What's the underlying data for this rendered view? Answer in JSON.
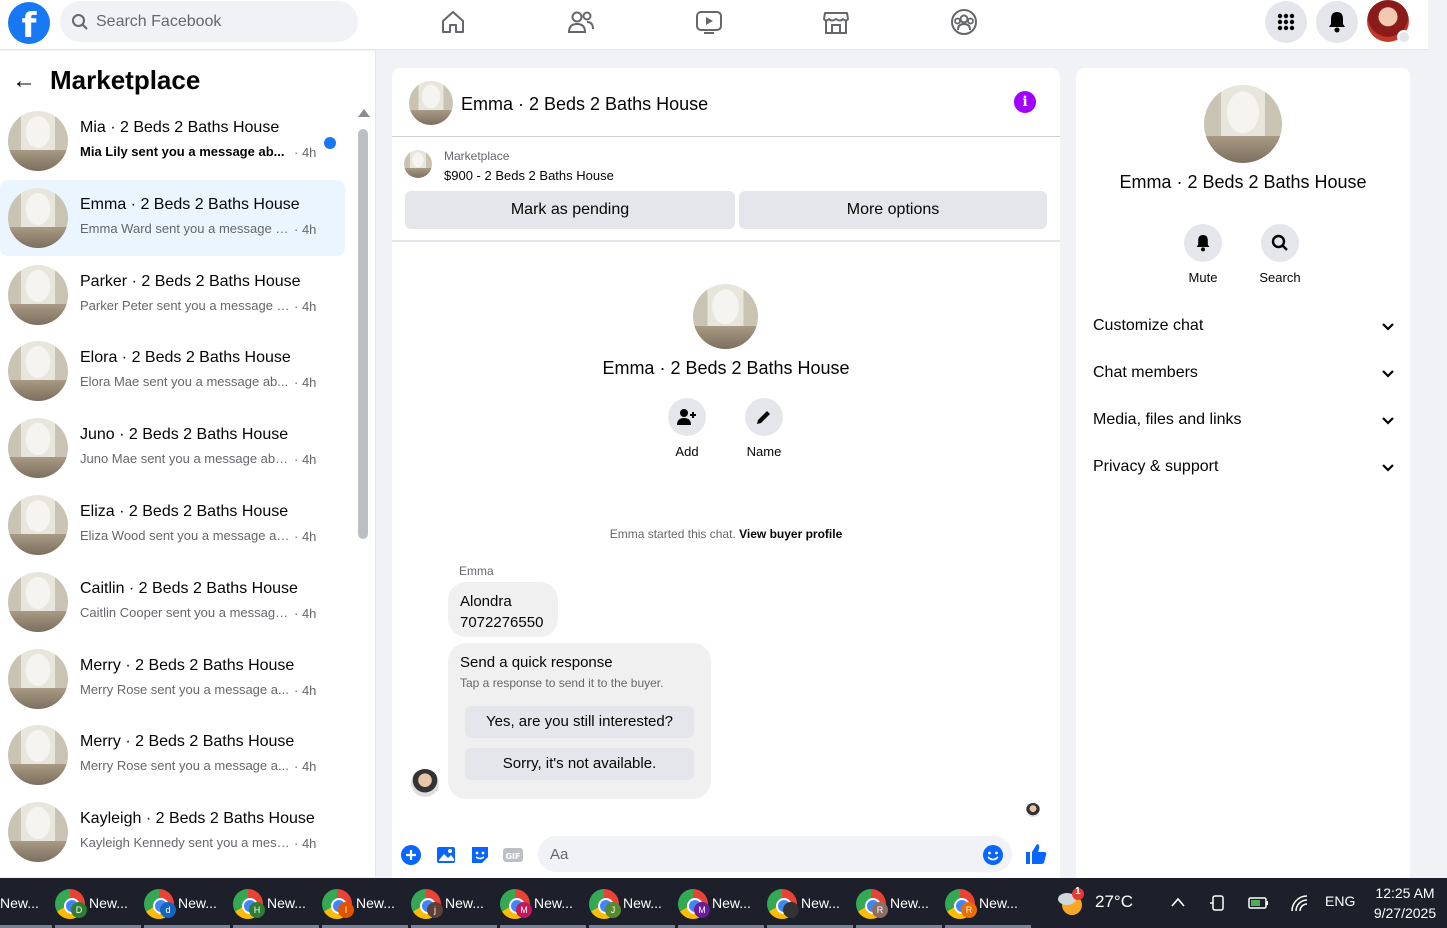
{
  "topbar": {
    "logo": "f",
    "search_placeholder": "Search Facebook",
    "nav_icons": [
      "home-icon",
      "friends-icon",
      "video-icon",
      "marketplace-icon",
      "groups-icon"
    ],
    "right_icons": [
      "menu-grid-icon",
      "bell-icon"
    ]
  },
  "left": {
    "back": "←",
    "title": "Marketplace",
    "conversations": [
      {
        "title": "Mia · 2 Beds 2 Baths House",
        "subtitle": "Mia Lily sent you a message ab...",
        "time": "· 4h",
        "unread": true
      },
      {
        "title": "Emma · 2 Beds 2 Baths House",
        "subtitle": "Emma Ward sent you a message a...",
        "time": "· 4h",
        "active": true
      },
      {
        "title": "Parker · 2 Beds 2 Baths House",
        "subtitle": "Parker Peter sent you a message a...",
        "time": "· 4h"
      },
      {
        "title": "Elora · 2 Beds 2 Baths House",
        "subtitle": "Elora Mae sent you a message ab...",
        "time": "· 4h"
      },
      {
        "title": "Juno · 2 Beds 2 Baths House",
        "subtitle": "Juno Mae sent you a message abo...",
        "time": "· 4h"
      },
      {
        "title": "Eliza · 2 Beds 2 Baths House",
        "subtitle": "Eliza Wood sent you a message ab...",
        "time": "· 4h"
      },
      {
        "title": "Caitlin · 2 Beds 2 Baths House",
        "subtitle": "Caitlin Cooper sent you a message...",
        "time": "· 4h"
      },
      {
        "title": "Merry · 2 Beds 2 Baths House",
        "subtitle": "Merry Rose sent you a message a...",
        "time": "· 4h"
      },
      {
        "title": "Merry · 2 Beds 2 Baths House",
        "subtitle": "Merry Rose sent you a message a...",
        "time": "· 4h"
      },
      {
        "title": "Kayleigh · 2 Beds 2 Baths House",
        "subtitle": "Kayleigh Kennedy sent you a mess...",
        "time": "· 4h"
      }
    ]
  },
  "chat": {
    "title": "Emma · 2 Beds 2 Baths House",
    "listing_source": "Marketplace",
    "listing_item": "$900 - 2 Beds 2 Baths House",
    "mark_pending": "Mark as pending",
    "more_options": "More options",
    "profile_name": "Emma · 2 Beds 2 Baths House",
    "add_label": "Add",
    "name_label": "Name",
    "started_text": "Emma started this chat.",
    "view_profile": "View buyer profile",
    "sender": "Emma",
    "message_line1": "Alondra",
    "message_line2": "7072276550",
    "quick_title": "Send a quick response",
    "quick_sub": "Tap a response to send it to the buyer.",
    "quick_option1": "Yes, are you still interested?",
    "quick_option2": "Sorry, it's not available.",
    "composer_placeholder": "Aa"
  },
  "right": {
    "name": "Emma · 2 Beds 2 Baths House",
    "mute": "Mute",
    "search": "Search",
    "sections": [
      "Customize chat",
      "Chat members",
      "Media, files and links",
      "Privacy & support"
    ]
  },
  "taskbar": {
    "tasks": [
      {
        "label": "New...",
        "badge": ""
      },
      {
        "label": "New...",
        "badge": "D",
        "color": "#2e7d32"
      },
      {
        "label": "New...",
        "badge": "d",
        "color": "#1565c0"
      },
      {
        "label": "New...",
        "badge": "H",
        "color": "#2e7d32"
      },
      {
        "label": "New...",
        "badge": "I",
        "color": "#e65100"
      },
      {
        "label": "New...",
        "badge": "j",
        "color": "#5d4037"
      },
      {
        "label": "New...",
        "badge": "M",
        "color": "#c2185b"
      },
      {
        "label": "New...",
        "badge": "J",
        "color": "#558b2f"
      },
      {
        "label": "New...",
        "badge": "M",
        "color": "#6a1b9a"
      },
      {
        "label": "New...",
        "badge": "",
        "color": "#333333"
      },
      {
        "label": "New...",
        "badge": "R",
        "color": "#8d6e63"
      },
      {
        "label": "New...",
        "badge": "R",
        "color": "#ef6c00"
      }
    ],
    "weather_badge": "1",
    "temperature": "27°C",
    "language": "ENG",
    "time": "12:25 AM",
    "date": "9/27/2025"
  }
}
